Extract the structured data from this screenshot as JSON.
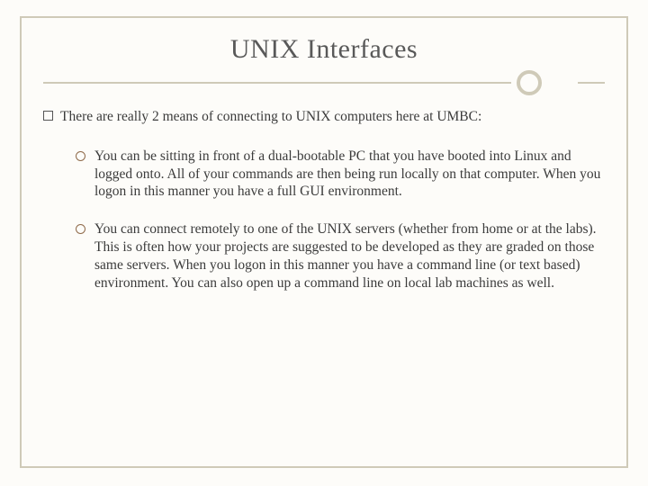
{
  "slide": {
    "title": "UNIX Interfaces",
    "intro": "There are really 2 means of connecting to UNIX computers here at UMBC:",
    "items": [
      "You can be sitting in front of a dual-bootable PC that you have booted into Linux and logged onto. All of your commands are then being run locally on that computer. When you logon in this manner you have a full GUI environment.",
      "You can connect remotely to one of the UNIX servers (whether from home or at the labs). This is often how your projects are suggested to be developed as they are graded on those same servers. When you logon in this manner you have a command line (or text based) environment. You can also open up a command line on local lab machines as well."
    ]
  }
}
